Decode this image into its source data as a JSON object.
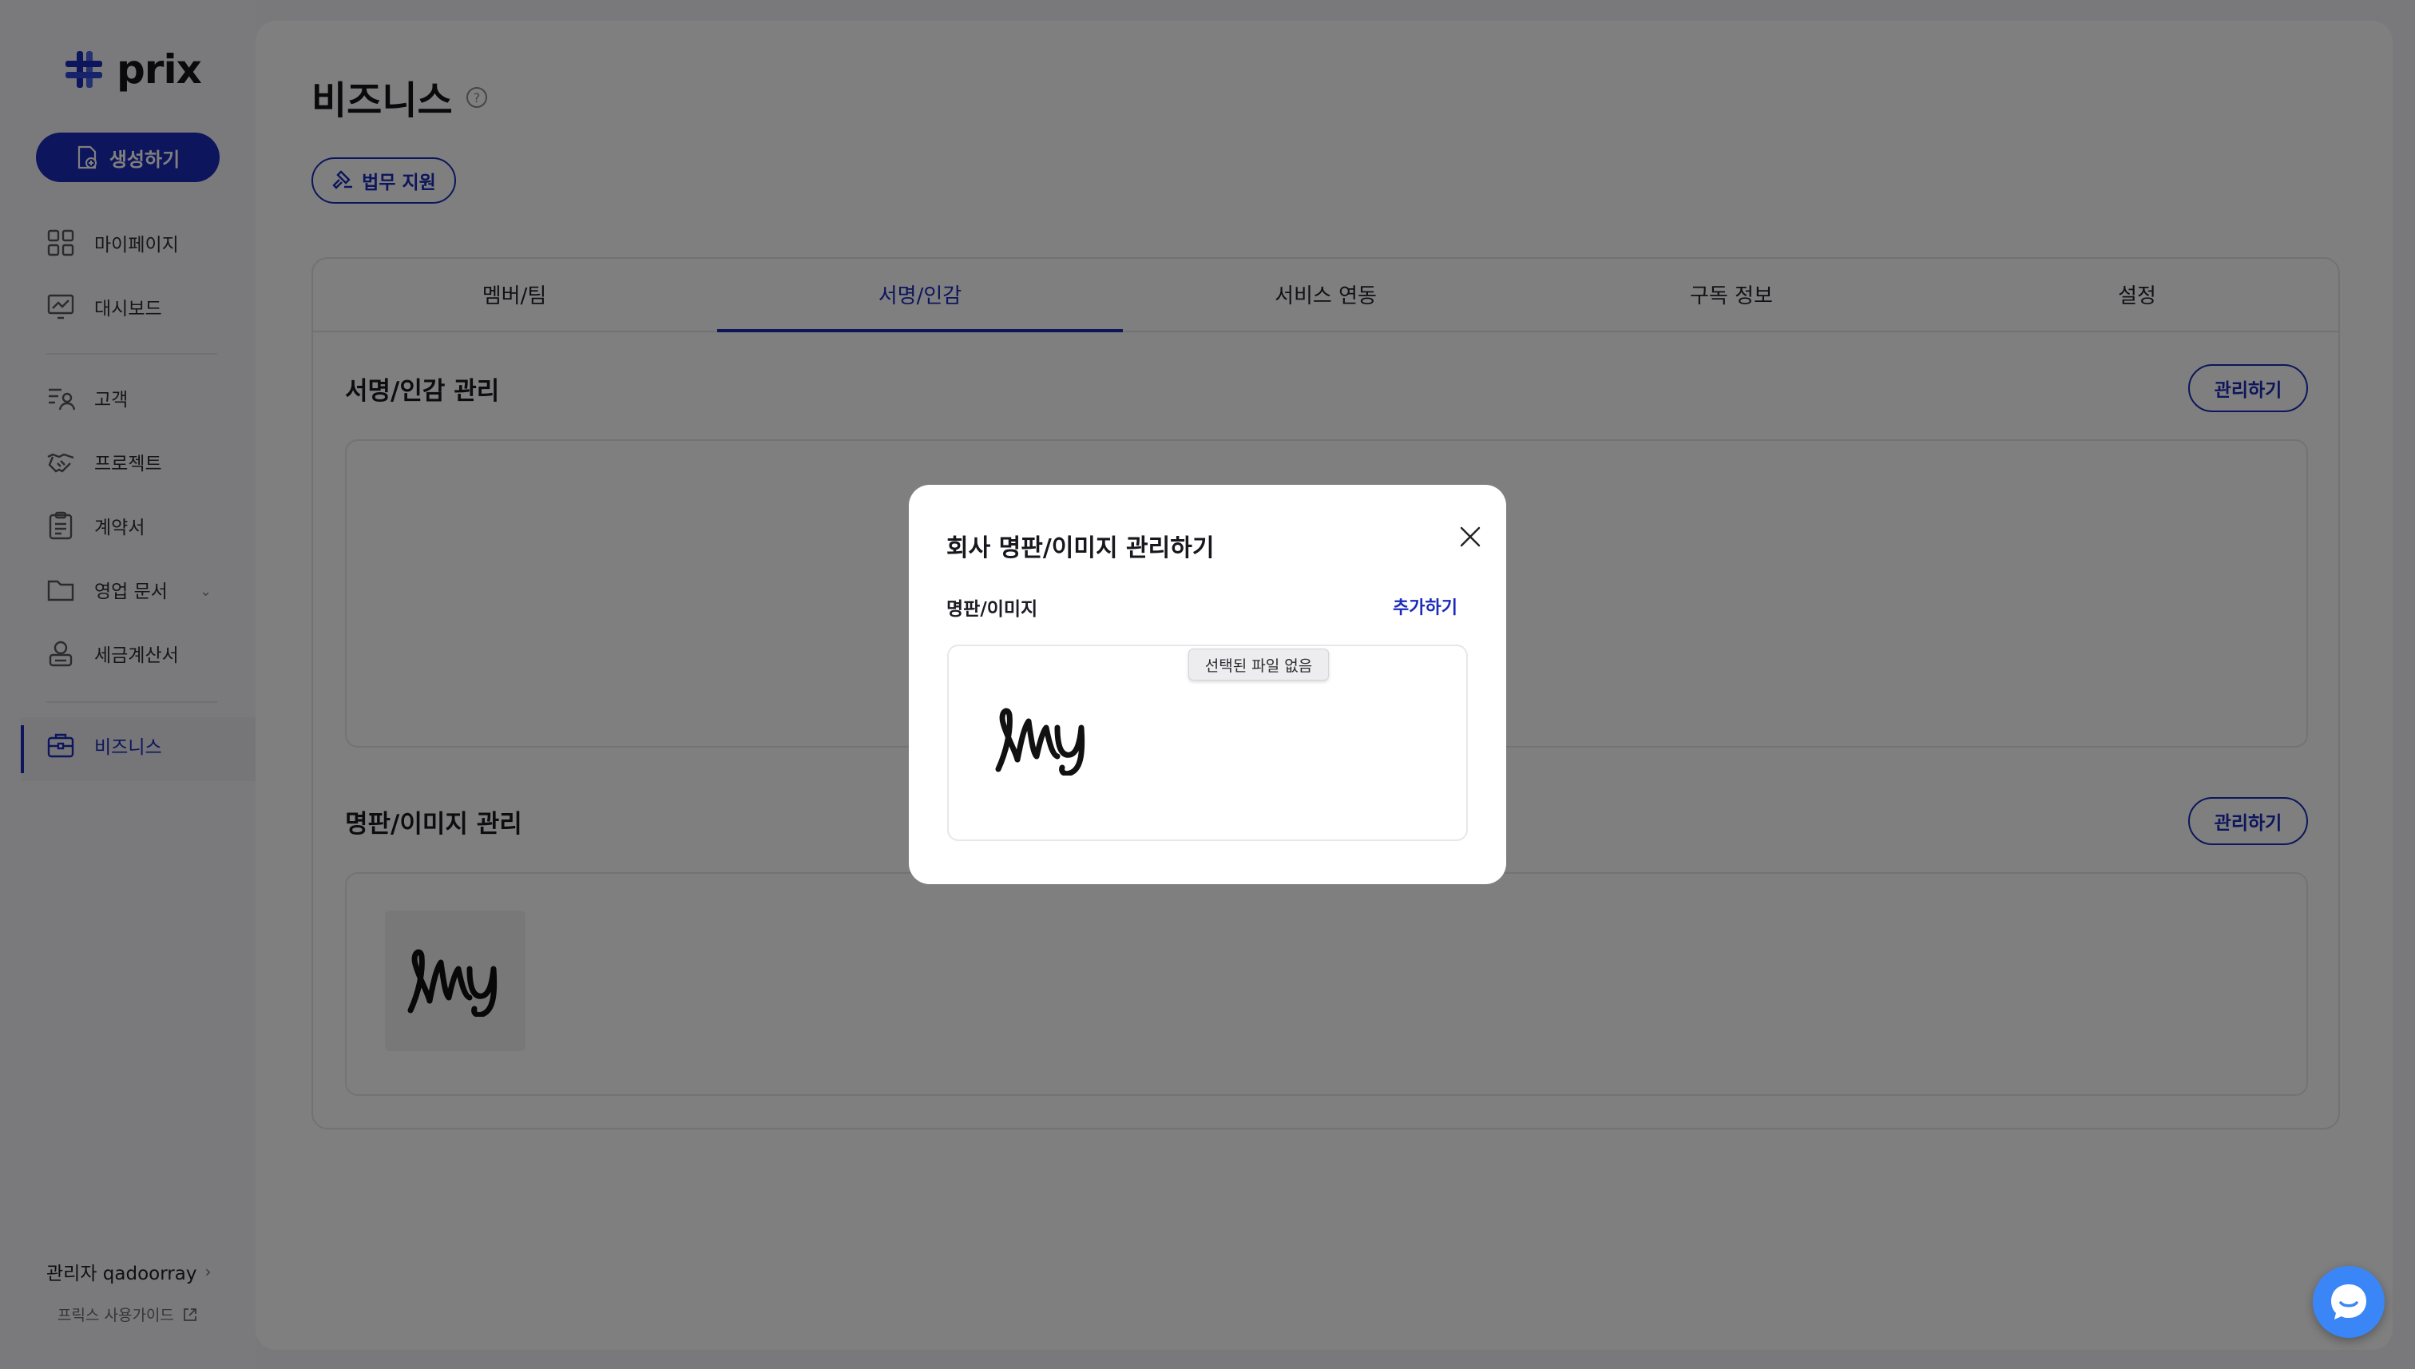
{
  "brand": {
    "name": "prix",
    "accent": "#1a2bb8"
  },
  "sidebar": {
    "create_label": "생성하기",
    "items": [
      {
        "label": "마이페이지",
        "icon": "grid-icon"
      },
      {
        "label": "대시보드",
        "icon": "dashboard-icon"
      },
      {
        "label": "고객",
        "icon": "customer-icon"
      },
      {
        "label": "프로젝트",
        "icon": "handshake-icon"
      },
      {
        "label": "계약서",
        "icon": "clipboard-icon"
      },
      {
        "label": "영업 문서",
        "icon": "folder-icon"
      },
      {
        "label": "세금계산서",
        "icon": "tax-icon"
      },
      {
        "label": "비즈니스",
        "icon": "briefcase-icon"
      }
    ],
    "admin": "관리자 qadoorray",
    "guide": "프릭스 사용가이드"
  },
  "page": {
    "title": "비즈니스",
    "legal_button": "법무 지원",
    "tabs": [
      "멤버/팀",
      "서명/인감",
      "서비스 연동",
      "구독 정보",
      "설정"
    ],
    "active_tab": "서명/인감",
    "sections": {
      "signature_title": "서명/인감 관리",
      "nameplate_title": "명판/이미지 관리",
      "manage_label": "관리하기"
    }
  },
  "modal": {
    "title": "회사 명판/이미지 관리하기",
    "label": "명판/이미지",
    "add_label": "추가하기",
    "tooltip": "선택된 파일 없음"
  }
}
